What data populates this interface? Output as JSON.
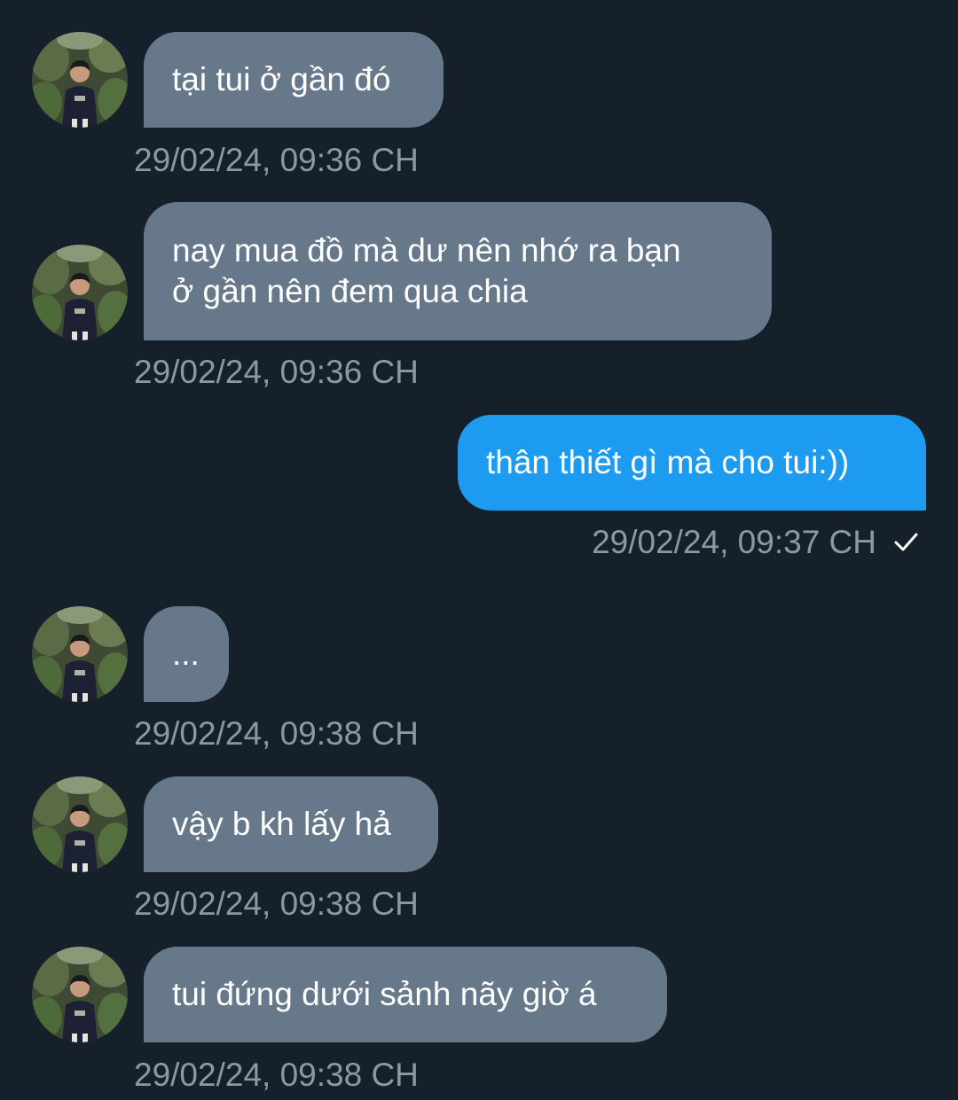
{
  "colors": {
    "background": "#15202b",
    "incoming_bubble": "#66788a",
    "outgoing_bubble": "#1d9bf0",
    "timestamp": "#8b98a5"
  },
  "avatar_icon": "profile-photo-icon",
  "messages": [
    {
      "direction": "incoming",
      "text": "tại tui ở gần đó",
      "time": "29/02/24, 09:36 CH"
    },
    {
      "direction": "incoming",
      "text": "nay mua đồ mà dư nên nhớ ra bạn\nở gần nên đem qua chia",
      "time": "29/02/24, 09:36 CH"
    },
    {
      "direction": "outgoing",
      "text": "thân thiết gì mà cho tui:))",
      "time": "29/02/24, 09:37 CH",
      "status_icon": "checkmark-icon"
    },
    {
      "direction": "incoming",
      "text": "...",
      "time": "29/02/24, 09:38 CH"
    },
    {
      "direction": "incoming",
      "text": "vậy b kh lấy hả",
      "time": "29/02/24, 09:38 CH"
    },
    {
      "direction": "incoming",
      "text": "tui đứng dưới sảnh nãy giờ á",
      "time": "29/02/24, 09:38 CH"
    }
  ]
}
